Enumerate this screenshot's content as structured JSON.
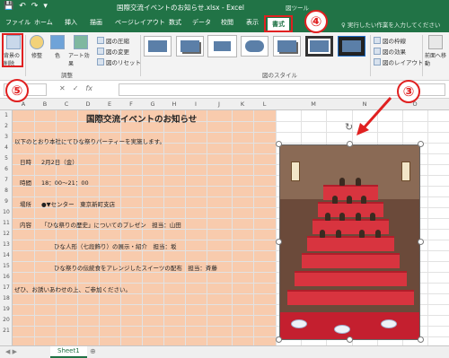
{
  "title_bar": {
    "qat": [
      "💾",
      "↶",
      "↷",
      "▾"
    ],
    "title": "国際交流イベントのお知らせ.xlsx - Excel",
    "picture_tools": "図ツール"
  },
  "tabs": [
    {
      "label": "ファイル",
      "active": false
    },
    {
      "label": "ホーム",
      "active": false
    },
    {
      "label": "挿入",
      "active": false
    },
    {
      "label": "描画",
      "active": false
    },
    {
      "label": "ページレイアウト",
      "active": false
    },
    {
      "label": "数式",
      "active": false
    },
    {
      "label": "データ",
      "active": false
    },
    {
      "label": "校閲",
      "active": false
    },
    {
      "label": "表示",
      "active": false
    },
    {
      "label": "書式",
      "active": true
    }
  ],
  "search_hint": "♀ 実行したい作業を入力してください",
  "ribbon": {
    "remove_bg": "背景の削除",
    "correct": "修整",
    "color": "色",
    "art": "アート効果",
    "compress": "図の圧縮",
    "change": "図の変更",
    "reset": "図のリセット",
    "adjust_group": "調整",
    "styles_group": "図のスタイル",
    "border": "図の枠線",
    "effects": "図の効果",
    "layout": "図のレイアウト",
    "bring_forward": "前面へ移動"
  },
  "formula_bar": {
    "name_box": "",
    "cancel": "✕",
    "enter": "✓",
    "fx": "fx"
  },
  "columns": [
    "A",
    "B",
    "C",
    "D",
    "E",
    "F",
    "G",
    "H",
    "I",
    "J",
    "K",
    "L",
    "M",
    "N",
    "O"
  ],
  "rows": [
    "1",
    "2",
    "3",
    "4",
    "5",
    "6",
    "7",
    "8",
    "9",
    "10",
    "11",
    "12",
    "13",
    "14",
    "15",
    "16",
    "17",
    "18",
    "19",
    "20",
    "21"
  ],
  "sheet": {
    "title": "国際交流イベントのお知らせ",
    "intro": "以下のとおり本社にてひな祭りパーティーを実施します。",
    "date_label": "日時",
    "date_value": "2月2日（金）",
    "time_label": "時間",
    "time_value": "18：00～21：00",
    "place_label": "場所",
    "place_value": "●▼センター　東京新町支店",
    "content_label": "内容",
    "content_1": "「ひな祭りの歴史」についてのプレゼン　担当：山田",
    "content_2": "ひな人形（七段飾り）の展示・紹介　担当：坂",
    "content_3": "ひな祭りの伝統食をアレンジしたスイーツの配布　担当：斉藤",
    "closing": "ぜひ、お誘いあわせの上、ご参加ください。"
  },
  "annotations": {
    "step3": "③",
    "step4": "④",
    "step5": "⑤"
  },
  "sheet_tabs": {
    "nav": "◀ ▶",
    "active": "Sheet1",
    "add": "⊕"
  },
  "colors": {
    "excel_green": "#217346",
    "highlight_red": "#e02020",
    "cell_fill": "#f8cbad"
  }
}
